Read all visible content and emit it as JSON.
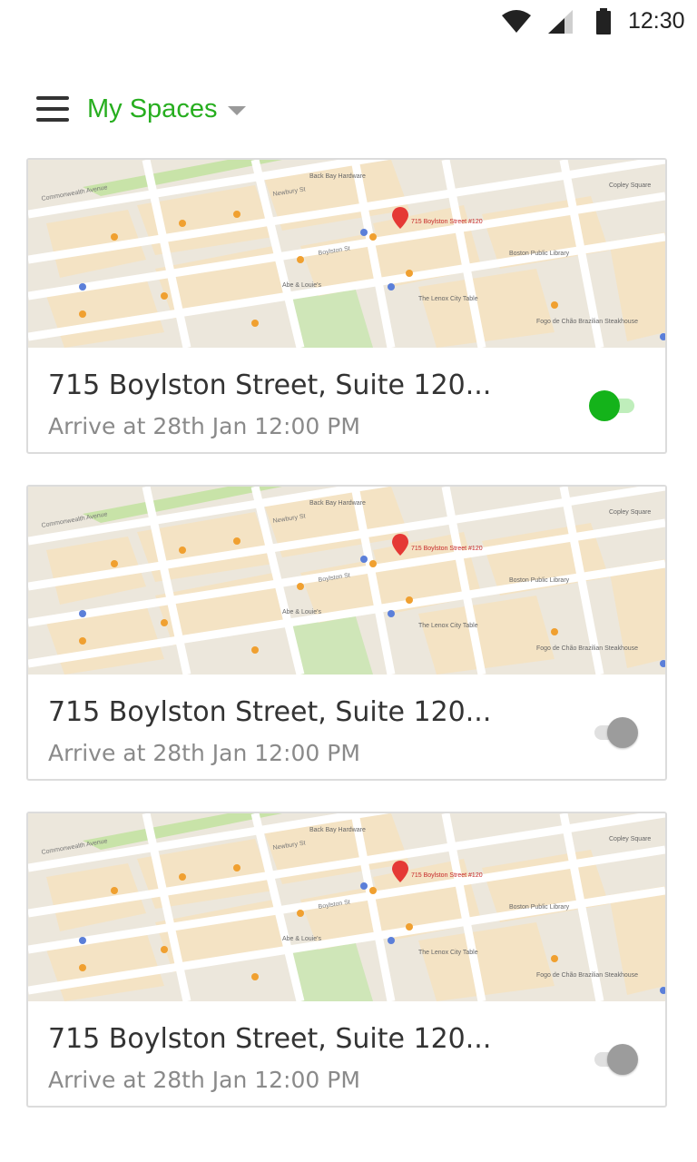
{
  "status_bar": {
    "time": "12:30"
  },
  "app_bar": {
    "title": "My Spaces"
  },
  "cards": [
    {
      "address": "715 Boylston Street, Suite 120...",
      "arrive": "Arrive at 28th Jan 12:00 PM",
      "enabled": true
    },
    {
      "address": "715 Boylston Street, Suite 120...",
      "arrive": "Arrive at 28th Jan 12:00 PM",
      "enabled": false
    },
    {
      "address": "715 Boylston Street, Suite 120...",
      "arrive": "Arrive at 28th Jan 12:00 PM",
      "enabled": false
    }
  ],
  "map_labels": {
    "street_commonwealth": "Commonwealth Avenue",
    "newbury": "Newbury St",
    "boylston": "Boylston St",
    "pin": "715 Boylston Street #120",
    "library": "Boston Public Library",
    "copley": "Copley Square",
    "abe": "Abe & Louie's",
    "back_bay": "Back Bay Hardware",
    "lenox": "The Lenox City Table",
    "fogo": "Fogo de Chão Brazilian Steakhouse"
  },
  "colors": {
    "accent": "#27ae1f",
    "toggle_on": "#14b31a",
    "toggle_off": "#9c9c9c"
  },
  "icons": {
    "menu": "menu-icon",
    "dropdown": "dropdown-arrow-icon",
    "wifi": "wifi-icon",
    "signal": "signal-icon",
    "battery": "battery-icon"
  }
}
